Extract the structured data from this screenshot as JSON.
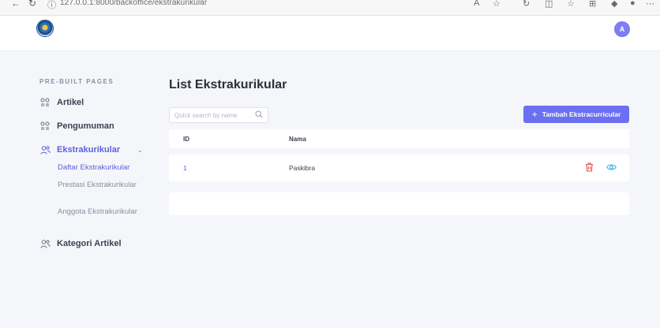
{
  "browser": {
    "url": "127.0.0.1:8000/backoffice/ekstrakurikular",
    "back_icon": "back-arrow-icon",
    "reload_icon": "reload-icon"
  },
  "header": {
    "logo_icon": "school-logo",
    "user_initial": "A"
  },
  "sidebar": {
    "section_title": "PRE-BUILT PAGES",
    "items": [
      {
        "label": "Artikel",
        "icon": "grid-people-icon"
      },
      {
        "label": "Pengumuman",
        "icon": "grid-people-icon"
      },
      {
        "label": "Ekstrakurikular",
        "icon": "users-icon",
        "expanded": true,
        "children": [
          {
            "label": "Daftar Ekstrakurikular",
            "active": true
          },
          {
            "label": "Prestasi Ekstrakurikular"
          },
          {
            "label": "Anggota Ekstrakurikular"
          }
        ]
      },
      {
        "label": "Kategori Artikel",
        "icon": "users-icon"
      }
    ]
  },
  "main": {
    "title": "List Ekstrakurikular",
    "search": {
      "placeholder": "Quick search by name",
      "value": ""
    },
    "add_button": {
      "label": "Tambah Ekstracurricular",
      "icon": "plus-icon"
    },
    "table": {
      "columns": [
        "ID",
        "Nama"
      ],
      "rows": [
        {
          "id": "1",
          "nama": "Paskibra"
        }
      ]
    }
  },
  "colors": {
    "accent": "#6b6ff2",
    "delete": "#e0504a",
    "view": "#3aaee0"
  }
}
